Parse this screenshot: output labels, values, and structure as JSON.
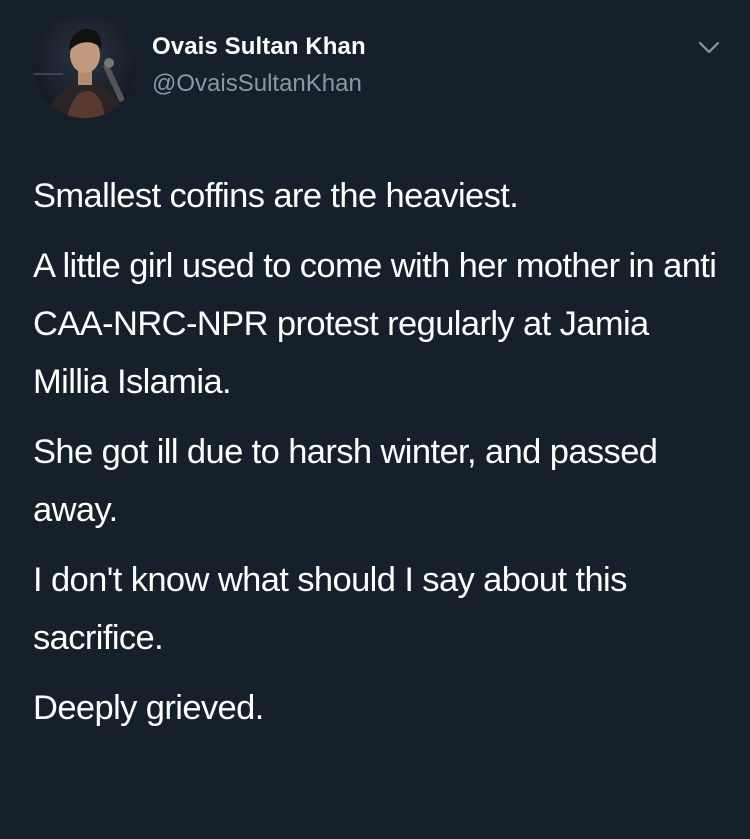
{
  "author": {
    "display_name": "Ovais Sultan Khan",
    "handle": "@OvaisSultanKhan",
    "avatar_icon": "profile-photo"
  },
  "menu": {
    "icon": "chevron-down-icon"
  },
  "tweet": {
    "paragraphs": [
      "Smallest coffins are the heaviest.",
      "A little girl used to come with her mother in anti CAA-NRC-NPR protest regularly at Jamia Millia Islamia.",
      "She got ill due to harsh winter, and passed away.",
      "I don't know what should I say about this sacrifice.",
      "Deeply grieved."
    ]
  },
  "colors": {
    "background": "#15202b",
    "text_primary": "#ffffff",
    "text_secondary": "#8899a6"
  }
}
